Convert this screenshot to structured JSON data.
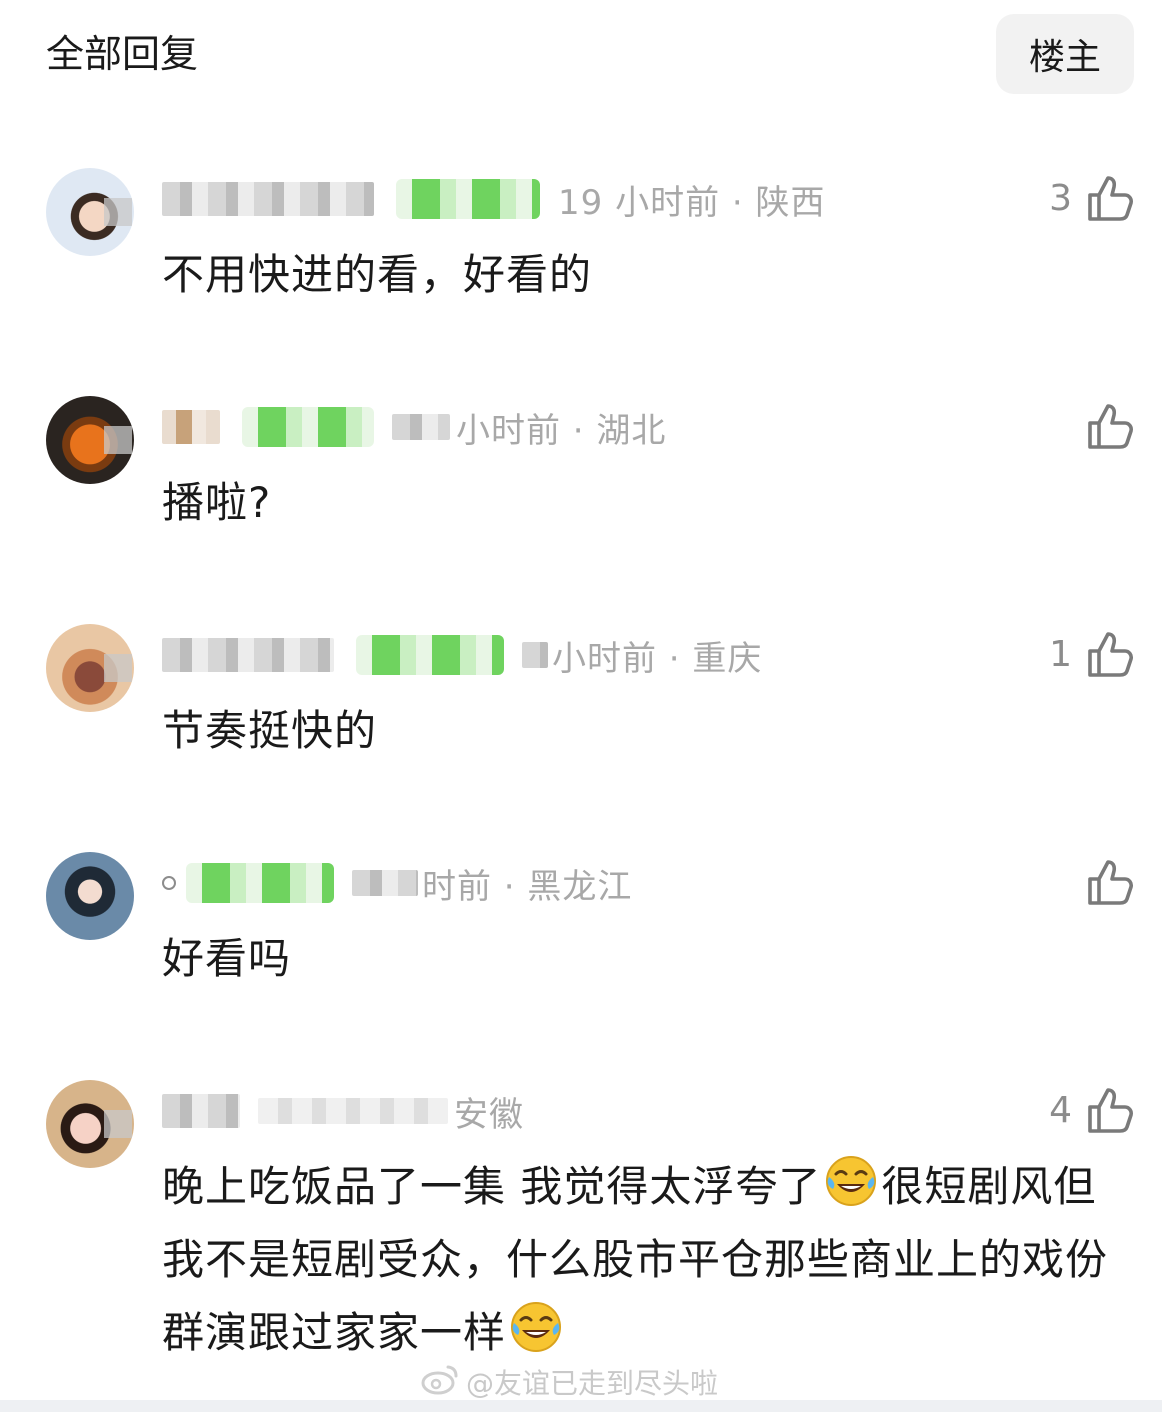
{
  "header": {
    "title": "全部回复",
    "filter_label": "楼主"
  },
  "comments": [
    {
      "time_location": "19 小时前 · 陕西",
      "likes": "3",
      "text": "不用快进的看，好看的"
    },
    {
      "time_location": "小时前 · 湖北",
      "likes": "",
      "text": "播啦?"
    },
    {
      "time_location": "小时前 · 重庆",
      "likes": "1",
      "text": "节奏挺快的"
    },
    {
      "time_location": "时前 · 黑龙江",
      "likes": "",
      "text": "好看吗"
    },
    {
      "time_location": "安徽",
      "likes": "4",
      "text_parts": [
        "晚上吃饭品了一集 我觉得太浮夸了",
        "很短剧风但我不是短剧受众，什么股市平仓那些商业上的戏份群演跟过家家一样",
        ""
      ]
    }
  ],
  "watermark": "@友谊已走到尽头啦",
  "colors": {
    "badge_green": "#6fd35f",
    "meta_gray": "#a8a8a8",
    "like_gray": "#8c8c8c"
  },
  "icons": {
    "like": "thumbs-up-icon",
    "emoji": "tears-of-joy-emoji",
    "watermark": "weibo-logo-icon"
  }
}
